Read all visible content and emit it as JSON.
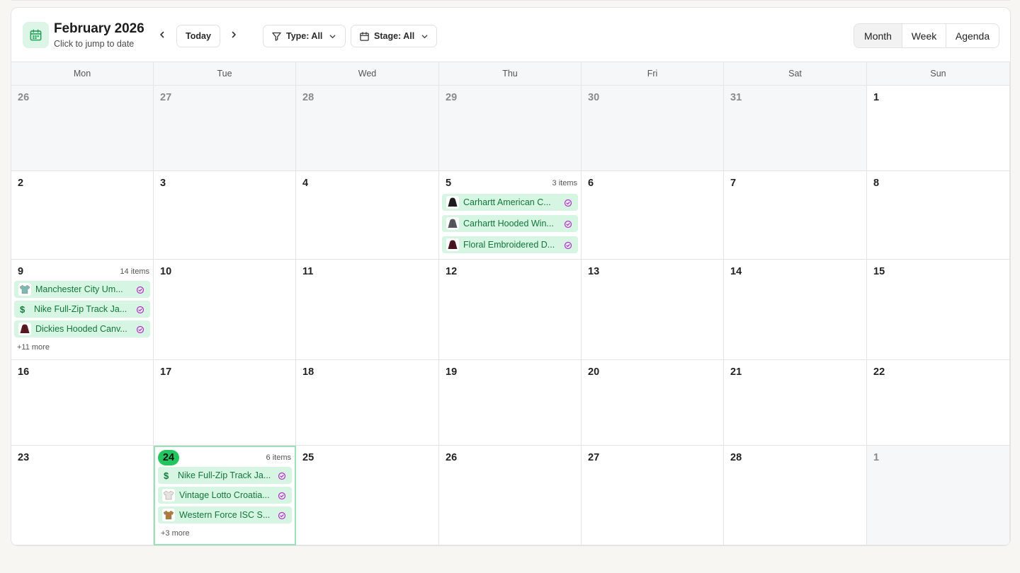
{
  "header": {
    "title": "February 2026",
    "subtitle": "Click to jump to date",
    "today_label": "Today",
    "type_filter": "Type: All",
    "stage_filter": "Stage: All",
    "views": [
      "Month",
      "Week",
      "Agenda"
    ],
    "active_view": "Month",
    "accent": "#22c55e"
  },
  "weekdays": [
    "Mon",
    "Tue",
    "Wed",
    "Thu",
    "Fri",
    "Sat",
    "Sun"
  ],
  "weeks": [
    [
      {
        "day": "26",
        "muted": true
      },
      {
        "day": "27",
        "muted": true
      },
      {
        "day": "28",
        "muted": true
      },
      {
        "day": "29",
        "muted": true
      },
      {
        "day": "30",
        "muted": true
      },
      {
        "day": "31",
        "muted": true
      },
      {
        "day": "1"
      }
    ],
    [
      {
        "day": "2"
      },
      {
        "day": "3"
      },
      {
        "day": "4"
      },
      {
        "day": "5",
        "count": "3 items",
        "events": [
          {
            "title": "Carhartt American C...",
            "thumb": "black-jacket-icon"
          },
          {
            "title": "Carhartt Hooded Win...",
            "thumb": "gray-jacket-icon"
          },
          {
            "title": "Floral Embroidered D...",
            "thumb": "maroon-jacket-icon"
          }
        ]
      },
      {
        "day": "6"
      },
      {
        "day": "7"
      },
      {
        "day": "8"
      }
    ],
    [
      {
        "day": "9",
        "count": "14 items",
        "more": "+11 more",
        "events": [
          {
            "title": "Manchester City Um...",
            "thumb": "teal-shirt-icon"
          },
          {
            "title": "Nike Full-Zip Track Ja...",
            "thumb": "dollar-icon"
          },
          {
            "title": "Dickies Hooded Canv...",
            "thumb": "maroon-hoodie-icon"
          }
        ]
      },
      {
        "day": "10"
      },
      {
        "day": "11"
      },
      {
        "day": "12"
      },
      {
        "day": "13"
      },
      {
        "day": "14"
      },
      {
        "day": "15"
      }
    ],
    [
      {
        "day": "16"
      },
      {
        "day": "17"
      },
      {
        "day": "18"
      },
      {
        "day": "19"
      },
      {
        "day": "20"
      },
      {
        "day": "21"
      },
      {
        "day": "22"
      }
    ],
    [
      {
        "day": "23"
      },
      {
        "day": "24",
        "today": true,
        "count": "6 items",
        "more": "+3 more",
        "events": [
          {
            "title": "Nike Full-Zip Track Ja...",
            "thumb": "dollar-icon"
          },
          {
            "title": "Vintage Lotto Croatia...",
            "thumb": "white-shirt-icon"
          },
          {
            "title": "Western Force ISC S...",
            "thumb": "tan-shirt-icon"
          }
        ]
      },
      {
        "day": "25"
      },
      {
        "day": "26"
      },
      {
        "day": "27"
      },
      {
        "day": "28"
      },
      {
        "day": "1",
        "muted": true
      }
    ]
  ]
}
